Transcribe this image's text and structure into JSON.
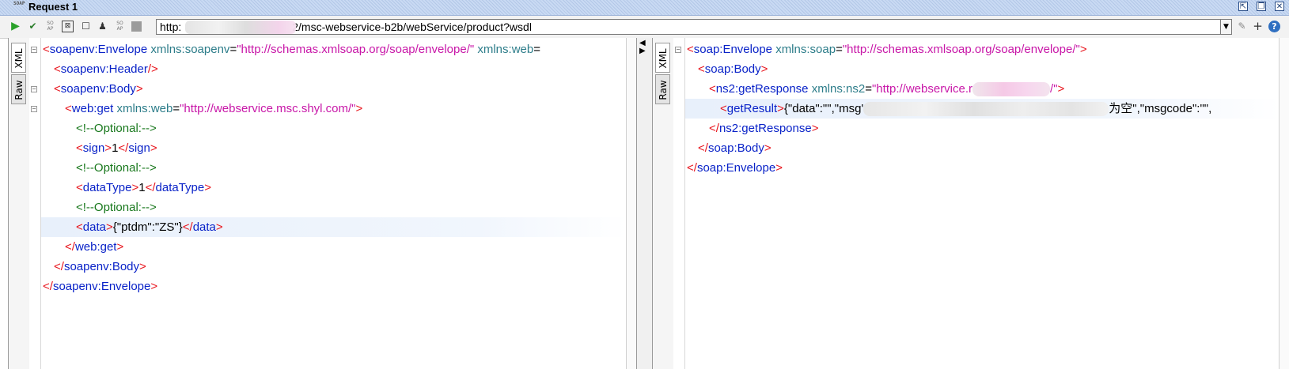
{
  "window": {
    "title": "Request 1",
    "logo_text": "SOAP"
  },
  "toolbar": {
    "endpoint_visible_prefix": "http:",
    "endpoint_visible_suffix": "2/msc-webservice-b2b/webService/product?wsdl"
  },
  "tabs": {
    "xml_label": "XML",
    "raw_label": "Raw"
  },
  "request": {
    "l1_tag": "soapenv:Envelope",
    "l1_attr1_name": "xmlns:soapenv",
    "l1_attr1_value": "\"http://schemas.xmlsoap.org/soap/envelope/\"",
    "l1_attr2_name": "xmlns:web",
    "l2_tag": "soapenv:Header",
    "l3_tag": "soapenv:Body",
    "l4_tag": "web:get",
    "l4_attr_name": "xmlns:web",
    "l4_attr_value": "\"http://webservice.msc.shyl.com/\"",
    "comment": "<!--Optional:-->",
    "sign_tag": "sign",
    "sign_value": "1",
    "datatype_tag": "dataType",
    "datatype_value": "1",
    "data_tag": "data",
    "data_value": "{\"ptdm\":\"ZS\"}",
    "close_get": "web:get",
    "close_body": "soapenv:Body",
    "close_envelope": "soapenv:Envelope"
  },
  "response": {
    "l1_tag": "soap:Envelope",
    "l1_attr_name": "xmlns:soap",
    "l1_attr_value": "\"http://schemas.xmlsoap.org/soap/envelope/\"",
    "l2_tag": "soap:Body",
    "l3_tag": "ns2:getResponse",
    "l3_attr_name": "xmlns:ns2",
    "l3_attr_value_prefix": "\"http://webservice.r",
    "l3_attr_value_suffix": "/\"",
    "l4_tag": "getResult",
    "l4_text_prefix": "{\"data\":\"\",\"msg'",
    "l4_text_suffix": "为空\",\"msgcode\":\"\",",
    "close_response": "ns2:getResponse",
    "close_body": "soap:Body",
    "close_envelope": "soap:Envelope"
  }
}
